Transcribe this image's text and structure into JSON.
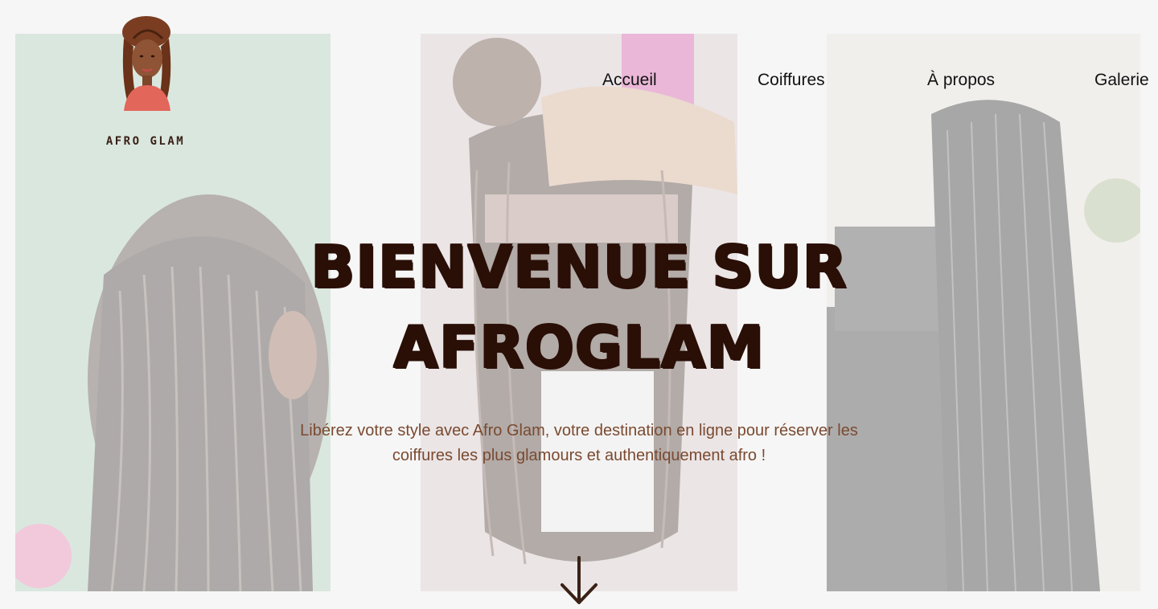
{
  "brand": {
    "logo_text": "AFRO GLAM",
    "accent_color": "#2a0f06",
    "subtitle_color": "#7a4a30"
  },
  "nav": {
    "items": [
      {
        "label": "Accueil"
      },
      {
        "label": "Coiffures"
      },
      {
        "label": "À propos"
      },
      {
        "label": "Galerie"
      }
    ]
  },
  "hero": {
    "title_line1": "BIENVENUE SUR",
    "title_line2": "AFROGLAM",
    "subtitle_line1": "Libérez votre style avec Afro Glam, votre destination en ligne pour réserver les",
    "subtitle_line2": "coiffures les plus glamours et authentiquement afro !",
    "scroll_icon": "arrow-down-icon"
  },
  "background_photos": [
    {
      "subject": "braids-photo-left"
    },
    {
      "subject": "braids-photo-center"
    },
    {
      "subject": "braids-photo-right"
    }
  ]
}
